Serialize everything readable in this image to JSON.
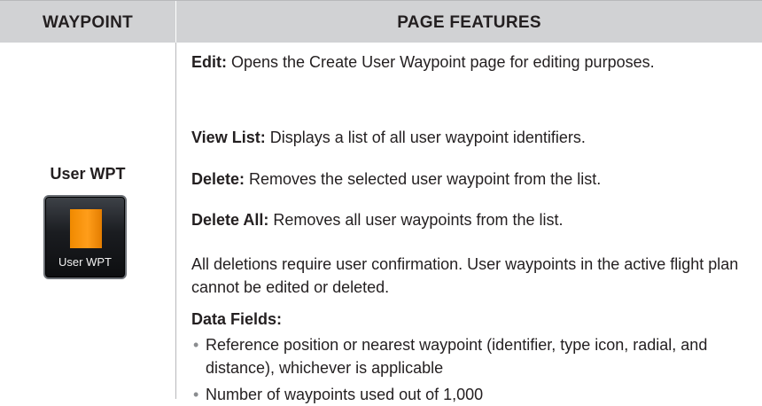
{
  "header": {
    "col1": "WAYPOINT",
    "col2": "PAGE FEATURES"
  },
  "waypoint": {
    "name": "User WPT",
    "button_label": "User WPT",
    "button_icon": "orange-square-icon",
    "icon_color": "#ff9100"
  },
  "features": [
    {
      "term": "Edit:",
      "text": " Opens the Create User Waypoint page for editing purposes."
    },
    {
      "term": "View List:",
      "text": " Displays a list of all user waypoint identifiers."
    },
    {
      "term": "Delete:",
      "text": " Removes the selected user waypoint from the list."
    },
    {
      "term": "Delete All:",
      "text": " Removes all user waypoints from the list."
    }
  ],
  "note": "All deletions require user confirmation. User waypoints in the active flight plan cannot be edited or deleted.",
  "data_fields": {
    "heading": "Data Fields:",
    "items": [
      "Reference position or nearest waypoint (identifier, type icon, radial, and distance), whichever is applicable",
      "Number of waypoints used out of 1,000"
    ]
  },
  "colors": {
    "header_bg": "#d1d2d4",
    "rule": "#b8b9bb",
    "text": "#231f20"
  }
}
